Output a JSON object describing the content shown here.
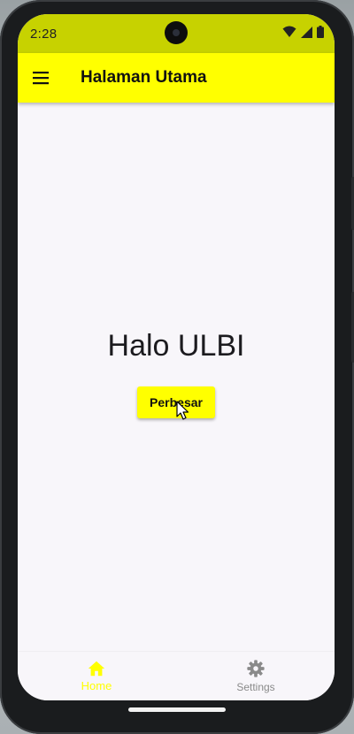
{
  "status_bar": {
    "time": "2:28",
    "icons": [
      "wifi-icon",
      "cell-signal-icon",
      "battery-icon"
    ]
  },
  "app_bar": {
    "title": "Halaman Utama",
    "menu_icon": "hamburger-menu-icon"
  },
  "main": {
    "greeting": "Halo ULBI",
    "enlarge_button_label": "Perbesar"
  },
  "bottom_nav": {
    "items": [
      {
        "label": "Home",
        "icon": "home-icon",
        "active": true
      },
      {
        "label": "Settings",
        "icon": "gear-icon",
        "active": false
      }
    ]
  },
  "colors": {
    "accent": "#ffff00",
    "status_bar": "#c7d200",
    "background": "#f8f6fa",
    "inactive_nav": "#8a8a8a"
  }
}
